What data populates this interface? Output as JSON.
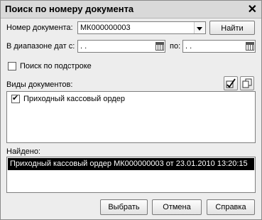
{
  "window": {
    "title": "Поиск по номеру документа",
    "close_glyph": "✕"
  },
  "doc_number": {
    "label": "Номер документа:",
    "value": "МК000000003",
    "find_label": "Найти"
  },
  "date_range": {
    "from_label": "В диапазоне дат с:",
    "from_value": " .  .",
    "to_label": "по:",
    "to_value": " .  ."
  },
  "substring_search": {
    "label": "Поиск по подстроке",
    "checked": false
  },
  "doc_types": {
    "label": "Виды документов:",
    "items": [
      {
        "label": "Приходный кассовый ордер",
        "checked": true
      }
    ]
  },
  "found": {
    "label": "Найдено:",
    "rows": [
      "Приходный кассовый ордер МК000000003 от 23.01.2010 13:20:15"
    ]
  },
  "buttons": {
    "select": "Выбрать",
    "cancel": "Отмена",
    "help": "Справка"
  },
  "icons": {
    "check_all": "check-all-icon",
    "copy": "copy-icon"
  }
}
